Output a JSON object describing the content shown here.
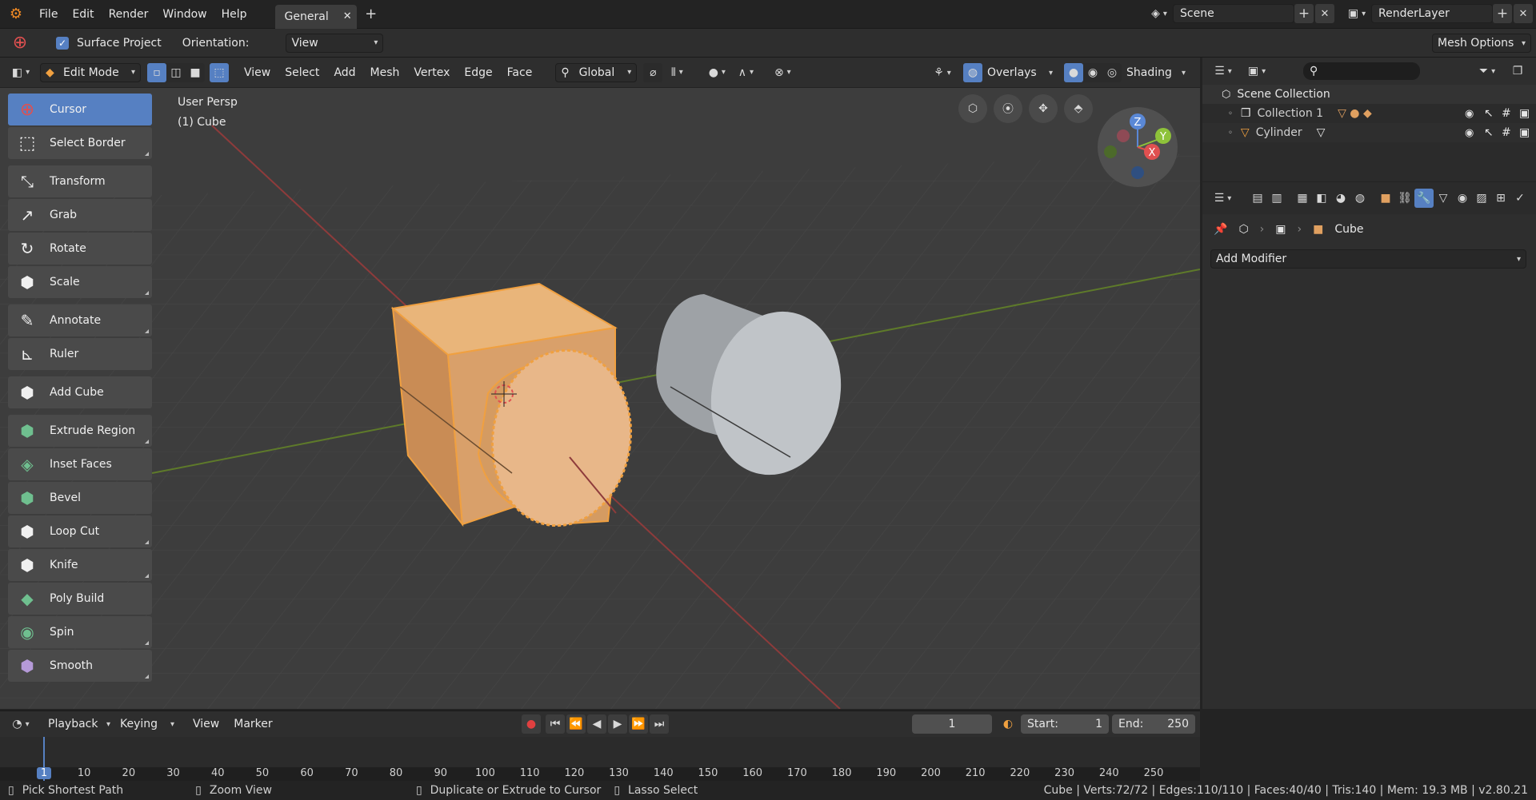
{
  "topbar": {
    "menus": [
      "File",
      "Edit",
      "Render",
      "Window",
      "Help"
    ],
    "workspace_tab": "General",
    "scene": "Scene",
    "render_layer": "RenderLayer"
  },
  "toolsettings": {
    "surface_project": "Surface Project",
    "orientation_label": "Orientation:",
    "orientation_value": "View",
    "mesh_options": "Mesh Options"
  },
  "viewport_header": {
    "mode": "Edit Mode",
    "menus": [
      "View",
      "Select",
      "Add",
      "Mesh",
      "Vertex",
      "Edge",
      "Face"
    ],
    "transform_orientation": "Global",
    "overlays": "Overlays",
    "shading": "Shading"
  },
  "viewport": {
    "view_name": "User Persp",
    "object_name": "(1) Cube",
    "gizmo_axes": [
      "Z",
      "Y",
      "X"
    ]
  },
  "tools": [
    {
      "label": "Cursor",
      "icon": "cursor-icon",
      "selected": true
    },
    {
      "label": "Select Border",
      "icon": "select-border-icon"
    },
    {
      "label": "Transform",
      "icon": "transform-icon"
    },
    {
      "label": "Grab",
      "icon": "grab-icon"
    },
    {
      "label": "Rotate",
      "icon": "rotate-icon"
    },
    {
      "label": "Scale",
      "icon": "scale-icon"
    },
    {
      "label": "Annotate",
      "icon": "annotate-icon"
    },
    {
      "label": "Ruler",
      "icon": "ruler-icon"
    },
    {
      "label": "Add Cube",
      "icon": "add-cube-icon"
    },
    {
      "label": "Extrude Region",
      "icon": "extrude-icon"
    },
    {
      "label": "Inset Faces",
      "icon": "inset-icon"
    },
    {
      "label": "Bevel",
      "icon": "bevel-icon"
    },
    {
      "label": "Loop Cut",
      "icon": "loop-cut-icon"
    },
    {
      "label": "Knife",
      "icon": "knife-icon"
    },
    {
      "label": "Poly Build",
      "icon": "poly-build-icon"
    },
    {
      "label": "Spin",
      "icon": "spin-icon"
    },
    {
      "label": "Smooth",
      "icon": "smooth-icon"
    }
  ],
  "outliner": {
    "root": "Scene Collection",
    "items": [
      "Collection 1",
      "Cylinder"
    ]
  },
  "properties": {
    "breadcrumb_object": "Cube",
    "add_modifier": "Add Modifier"
  },
  "timeline": {
    "menus": [
      "Playback",
      "Keying",
      "View",
      "Marker"
    ],
    "current_frame": "1",
    "start_label": "Start:",
    "start_value": "1",
    "end_label": "End:",
    "end_value": "250",
    "ticks": [
      "1",
      "10",
      "20",
      "30",
      "40",
      "50",
      "60",
      "70",
      "80",
      "90",
      "100",
      "110",
      "120",
      "130",
      "140",
      "150",
      "160",
      "170",
      "180",
      "190",
      "200",
      "210",
      "220",
      "230",
      "240",
      "250"
    ]
  },
  "statusbar": {
    "hints": [
      "Pick Shortest Path",
      "Zoom View",
      "Duplicate or Extrude to Cursor",
      "Lasso Select"
    ],
    "stats": "Cube | Verts:72/72 | Edges:110/110 | Faces:40/40 | Tris:140 | Mem: 19.3 MB | v2.80.21"
  },
  "colors": {
    "accent": "#5680c2",
    "selection_orange": "#f0a040",
    "viewport_bg": "#3d3d3d"
  }
}
